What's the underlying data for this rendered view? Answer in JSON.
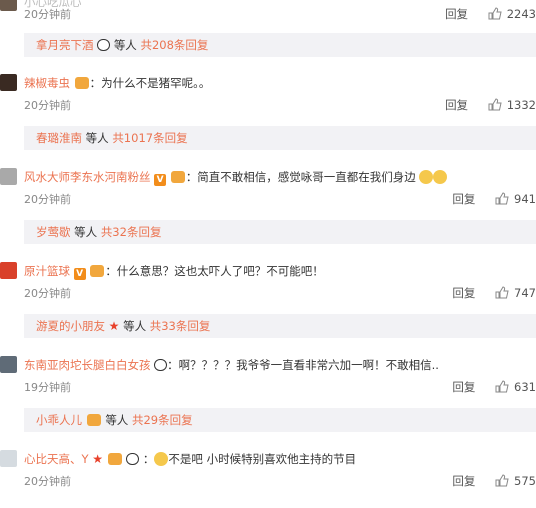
{
  "labels": {
    "reply": "回复",
    "and_others": "等人"
  },
  "top": {
    "username_partial": "小心吃瓜心",
    "time": "20分钟前",
    "likes": "2243",
    "replies_user": "拿月亮下酒",
    "replies_count": "共208条回复"
  },
  "comments": [
    {
      "username": "辣椒毒虫",
      "text": "：为什么不是猪罕呢。。",
      "time": "20分钟前",
      "likes": "1332",
      "replies_user": "春璐淮南",
      "replies_count": "共1017条回复"
    },
    {
      "username": "风水大师李东水河南粉丝",
      "text": "：简直不敢相信，感觉咏哥一直都在我们身边",
      "time": "20分钟前",
      "likes": "941",
      "replies_user": "岁莺歇",
      "replies_count": "共32条回复"
    },
    {
      "username": "原汁篮球",
      "text": "：什么意思？这也太吓人了吧？不可能吧！",
      "time": "20分钟前",
      "likes": "747",
      "replies_user": "游夏的小朋友",
      "replies_count": "共33条回复"
    },
    {
      "username": "东南亚肉坨长腿白白女孩",
      "text": "：啊？？？？我爷爷一直看非常六加一啊！不敢相信..",
      "time": "19分钟前",
      "likes": "631",
      "replies_user": "小乖人儿",
      "replies_count": "共29条回复"
    },
    {
      "username": "心比天高、Y",
      "text": "不是吧 小时候特别喜欢他主持的节目",
      "time": "20分钟前",
      "likes": "575"
    }
  ],
  "colors": {
    "username": "#eb7350",
    "reply_bg": "#f2f2f5",
    "time": "#888888"
  }
}
